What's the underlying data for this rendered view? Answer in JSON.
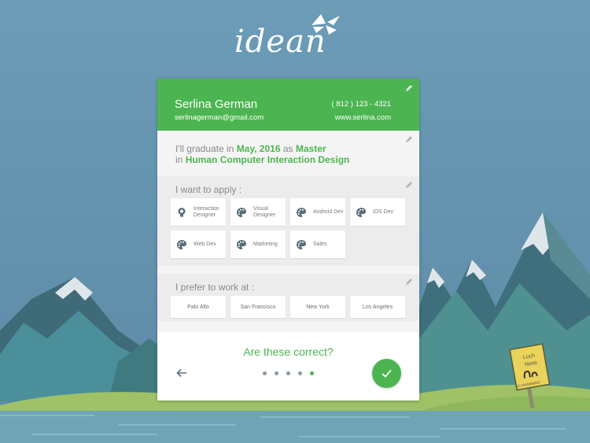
{
  "brand": {
    "logo_text": "idean"
  },
  "profile": {
    "name": "Serlina German",
    "email": "serlinagerman@gmail.com",
    "phone": "( 812 ) 123 - 4321",
    "website": "www.serlina.com"
  },
  "graduation": {
    "prefix": "I'll graduate in",
    "date": "May, 2016",
    "as_word": "as",
    "degree": "Master",
    "in_word": "in",
    "field": "Human Computer Interaction Design"
  },
  "apply": {
    "label": "I want to apply :",
    "roles": [
      {
        "label": "Interaction Designer",
        "icon": "lightbulb-icon"
      },
      {
        "label": "Visual Designer",
        "icon": "palette-icon"
      },
      {
        "label": "Android Dev",
        "icon": "palette-icon"
      },
      {
        "label": "iOS Dev",
        "icon": "palette-icon"
      },
      {
        "label": "Web Dev",
        "icon": "palette-icon"
      },
      {
        "label": "Marketing",
        "icon": "palette-icon"
      },
      {
        "label": "Sales",
        "icon": "palette-icon"
      }
    ]
  },
  "work": {
    "label": "I prefer to work at :",
    "locations": [
      "Palo Alto",
      "San Francisco",
      "New York",
      "Los Angeles"
    ]
  },
  "confirm": {
    "question": "Are these correct?",
    "steps_total": 5,
    "current_step": 5
  },
  "sign": {
    "line1": "Loch",
    "line2": "Ness",
    "plate": "NO SWIMMING"
  },
  "colors": {
    "accent": "#4cb551",
    "sky": "#6c9bb5",
    "icon": "#5a6e7a"
  }
}
